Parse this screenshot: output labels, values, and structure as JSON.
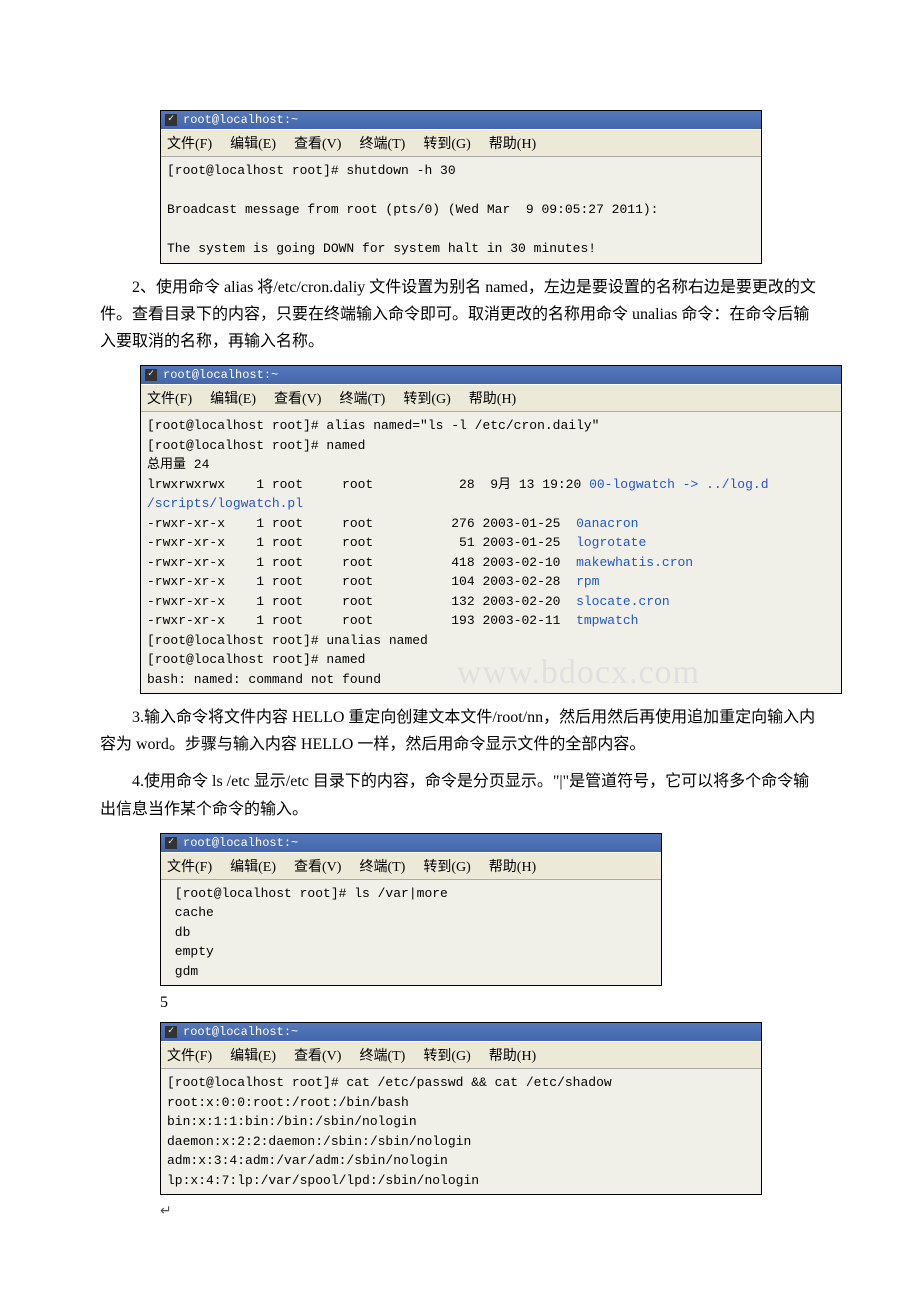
{
  "title": "root@localhost:~",
  "menu": {
    "file": "文件(F)",
    "edit": "编辑(E)",
    "view": "查看(V)",
    "terminal": "终端(T)",
    "go": "转到(G)",
    "help": "帮助(H)"
  },
  "term1": {
    "l1": "[root@localhost root]# shutdown -h 30",
    "l2": " ",
    "l3": "Broadcast message from root (pts/0) (Wed Mar  9 09:05:27 2011):",
    "l4": " ",
    "l5": "The system is going DOWN for system halt in 30 minutes!"
  },
  "para2": "2、使用命令 alias 将/etc/cron.daliy 文件设置为别名 named，左边是要设置的名称右边是要更改的文件。查看目录下的内容，只要在终端输入命令即可。取消更改的名称用命令 unalias 命令：在命令后输入要取消的名称，再输入名称。",
  "term2": {
    "l1": "[root@localhost root]# alias named=\"ls -l /etc/cron.daily\"",
    "l2": "[root@localhost root]# named",
    "l3": "总用量 24",
    "l4a": "lrwxrwxrwx    1 root     root           28  9月 13 19:20 ",
    "l4b": "00-logwatch -> ../log.d",
    "l5": "/scripts/logwatch.pl",
    "l6a": "-rwxr-xr-x    1 root     root          276 2003-01-25  ",
    "l6b": "0anacron",
    "l7a": "-rwxr-xr-x    1 root     root           51 2003-01-25  ",
    "l7b": "logrotate",
    "l8a": "-rwxr-xr-x    1 root     root          418 2003-02-10  ",
    "l8b": "makewhatis.cron",
    "l9a": "-rwxr-xr-x    1 root     root          104 2003-02-28  ",
    "l9b": "rpm",
    "l10a": "-rwxr-xr-x    1 root     root          132 2003-02-20  ",
    "l10b": "slocate.cron",
    "l11a": "-rwxr-xr-x    1 root     root          193 2003-02-11  ",
    "l11b": "tmpwatch",
    "l12": "[root@localhost root]# unalias named",
    "l13": "[root@localhost root]# named",
    "l14": "bash: named: command not found"
  },
  "watermark": "www.bdocx.com",
  "para3": "3.输入命令将文件内容 HELLO 重定向创建文本文件/root/nn，然后用然后再使用追加重定向输入内容为 word。步骤与输入内容 HELLO 一样，然后用命令显示文件的全部内容。",
  "para4": "4.使用命令 ls /etc 显示/etc 目录下的内容，命令是分页显示。\"|\"是管道符号，它可以将多个命令输出信息当作某个命令的输入。",
  "term3": {
    "l1": " [root@localhost root]# ls /var|more",
    "l2": " cache",
    "l3": " db",
    "l4": " empty",
    "l5": " gdm"
  },
  "num5": "5",
  "term4": {
    "l1": "[root@localhost root]# cat /etc/passwd && cat /etc/shadow",
    "l2": "root:x:0:0:root:/root:/bin/bash",
    "l3": "bin:x:1:1:bin:/bin:/sbin/nologin",
    "l4": "daemon:x:2:2:daemon:/sbin:/sbin/nologin",
    "l5": "adm:x:3:4:adm:/var/adm:/sbin/nologin",
    "l6": "lp:x:4:7:lp:/var/spool/lpd:/sbin/nologin"
  },
  "arrow": "↵"
}
